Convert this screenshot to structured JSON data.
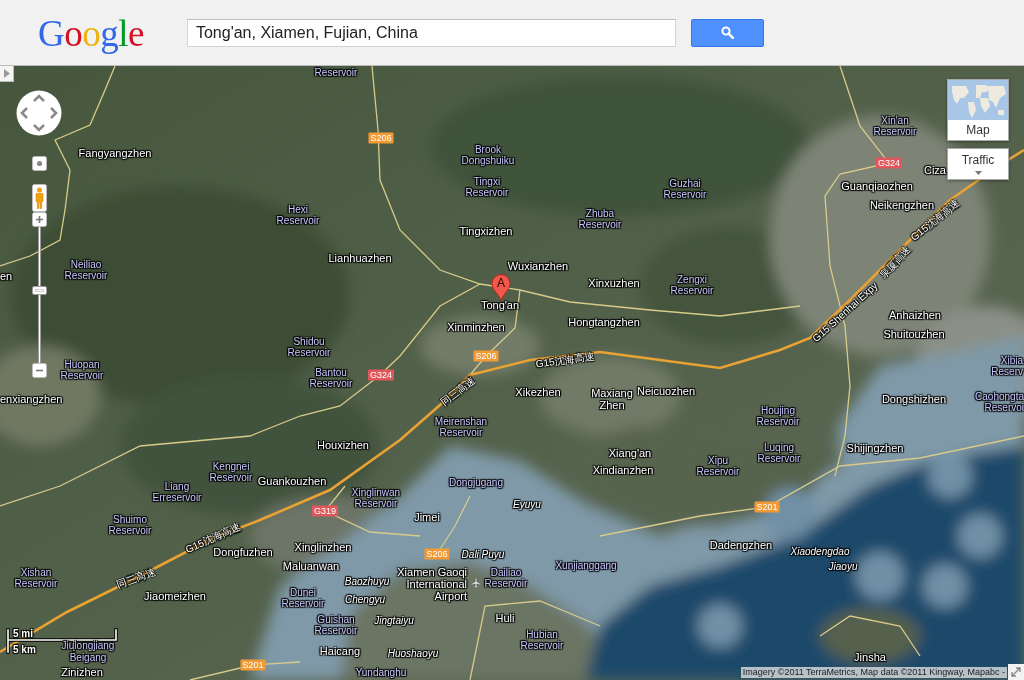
{
  "header": {
    "logo": "Google",
    "search": {
      "value": "Tong'an, Xiamen, Fujian, China"
    }
  },
  "map": {
    "labels": [
      {
        "kind": "water",
        "lines": [
          "Reservoir"
        ]
      },
      {
        "kind": "water",
        "lines": [
          "Xin'an",
          "Reservoir"
        ]
      },
      {
        "kind": "town",
        "lines": [
          "Fangyangzhen"
        ]
      },
      {
        "kind": "water",
        "lines": [
          "Brook",
          "Dongshuiku"
        ]
      },
      {
        "kind": "town",
        "lines": [
          "Ciza"
        ]
      },
      {
        "kind": "water",
        "lines": [
          "Tingxi",
          "Reservoir"
        ]
      },
      {
        "kind": "water",
        "lines": [
          "Guzhai",
          "Reservoir"
        ]
      },
      {
        "kind": "town",
        "lines": [
          "Guanqiaozhen"
        ]
      },
      {
        "kind": "water",
        "lines": [
          "Hexi",
          "Reservoir"
        ]
      },
      {
        "kind": "water",
        "lines": [
          "Zhuba",
          "Reservoir"
        ]
      },
      {
        "kind": "town",
        "lines": [
          "Neikengzhen"
        ]
      },
      {
        "kind": "town",
        "lines": [
          "Tingxizhen"
        ]
      },
      {
        "kind": "town",
        "lines": [
          "en"
        ]
      },
      {
        "kind": "water",
        "lines": [
          "Neiliao",
          "Reservoir"
        ]
      },
      {
        "kind": "town",
        "lines": [
          "Lianhuazhen"
        ]
      },
      {
        "kind": "town",
        "lines": [
          "Wuxianzhen"
        ]
      },
      {
        "kind": "town",
        "lines": [
          "Xinxuzhen"
        ]
      },
      {
        "kind": "water",
        "lines": [
          "Zengxi",
          "Reservoir"
        ]
      },
      {
        "kind": "town",
        "lines": [
          "Tong'an"
        ]
      },
      {
        "kind": "town",
        "lines": [
          "Xinminzhen"
        ]
      },
      {
        "kind": "town",
        "lines": [
          "Hongtangzhen"
        ]
      },
      {
        "kind": "town",
        "lines": [
          "Anhaizhen"
        ]
      },
      {
        "kind": "town",
        "lines": [
          "Shuitouzhen"
        ]
      },
      {
        "kind": "water",
        "lines": [
          "Shidou",
          "Reservoir"
        ]
      },
      {
        "kind": "water",
        "lines": [
          "Huopan",
          "Reservoir"
        ]
      },
      {
        "kind": "water",
        "lines": [
          "Bantou",
          "Reservoir"
        ]
      },
      {
        "kind": "water",
        "lines": [
          "Xibia",
          "Reserv"
        ]
      },
      {
        "kind": "town",
        "lines": [
          "enxiangzhen"
        ]
      },
      {
        "kind": "town",
        "lines": [
          "Xikezhen"
        ]
      },
      {
        "kind": "town",
        "lines": [
          "Maxiang",
          "Zhen"
        ]
      },
      {
        "kind": "town",
        "lines": [
          "Neicuozhen"
        ]
      },
      {
        "kind": "town",
        "lines": [
          "Dongshizhen"
        ]
      },
      {
        "kind": "water",
        "lines": [
          "Caohongta",
          "Reservoi"
        ]
      },
      {
        "kind": "water",
        "lines": [
          "Meirenshan",
          "Reservoir"
        ]
      },
      {
        "kind": "water",
        "lines": [
          "Houjing",
          "Reservoir"
        ]
      },
      {
        "kind": "town",
        "lines": [
          "Houxizhen"
        ]
      },
      {
        "kind": "town",
        "lines": [
          "Xiang'an"
        ]
      },
      {
        "kind": "water",
        "lines": [
          "Luqing",
          "Reservoir"
        ]
      },
      {
        "kind": "town",
        "lines": [
          "Shijingzhen"
        ]
      },
      {
        "kind": "water",
        "lines": [
          "Kengnei",
          "Reservoir"
        ]
      },
      {
        "kind": "town",
        "lines": [
          "Xindianzhen"
        ]
      },
      {
        "kind": "water",
        "lines": [
          "Xipu",
          "Reservoir"
        ]
      },
      {
        "kind": "water",
        "lines": [
          "Liang",
          "Erreservoir"
        ]
      },
      {
        "kind": "town",
        "lines": [
          "Guankouzhen"
        ]
      },
      {
        "kind": "water",
        "lines": [
          "Dongjugang"
        ]
      },
      {
        "kind": "water",
        "lines": [
          "Xinglinwan",
          "Reservoir"
        ]
      },
      {
        "kind": "island",
        "lines": [
          "Eyuyu"
        ]
      },
      {
        "kind": "water",
        "lines": [
          "Shuimo",
          "Reservoir"
        ]
      },
      {
        "kind": "town",
        "lines": [
          "Jimei"
        ]
      },
      {
        "kind": "town",
        "lines": [
          "Dongfuzhen"
        ]
      },
      {
        "kind": "town",
        "lines": [
          "Xinglinzhen"
        ]
      },
      {
        "kind": "island",
        "lines": [
          "Dali Puyu"
        ]
      },
      {
        "kind": "town",
        "lines": [
          "Dadengzhen"
        ]
      },
      {
        "kind": "island",
        "lines": [
          "Xiaodengdao"
        ]
      },
      {
        "kind": "town",
        "lines": [
          "Maluanwan"
        ]
      },
      {
        "kind": "water",
        "lines": [
          "Xunjianggang"
        ]
      },
      {
        "kind": "water",
        "lines": [
          "Xishan",
          "Reservoir"
        ]
      },
      {
        "kind": "island",
        "lines": [
          "Baozhuyu"
        ]
      },
      {
        "kind": "town",
        "lines": [
          "Jiaomeizhen"
        ]
      },
      {
        "kind": "water",
        "lines": [
          "Dunei",
          "Reservoir"
        ]
      },
      {
        "kind": "island",
        "lines": [
          "Chengyu"
        ]
      },
      {
        "kind": "airport",
        "lines": [
          "Xiamen Gaoqi",
          "International",
          "Airport"
        ]
      },
      {
        "kind": "water",
        "lines": [
          "Dailiao",
          "Reservoir"
        ]
      },
      {
        "kind": "island",
        "lines": [
          "Jiaoyu"
        ]
      },
      {
        "kind": "water",
        "lines": [
          "Guishan",
          "Reservoir"
        ]
      },
      {
        "kind": "island",
        "lines": [
          "Jingtaiyu"
        ]
      },
      {
        "kind": "town",
        "lines": [
          "Huli"
        ]
      },
      {
        "kind": "water",
        "lines": [
          "Jiulongjiang"
        ]
      },
      {
        "kind": "water",
        "lines": [
          "Beigang"
        ]
      },
      {
        "kind": "town",
        "lines": [
          "Haicang"
        ]
      },
      {
        "kind": "water",
        "lines": [
          "Hubian",
          "Reservoir"
        ]
      },
      {
        "kind": "island",
        "lines": [
          "Huoshaoyu"
        ]
      },
      {
        "kind": "town",
        "lines": [
          "Jinsha"
        ]
      },
      {
        "kind": "town",
        "lines": [
          "Zinizhen"
        ]
      },
      {
        "kind": "water",
        "lines": [
          "Yundanghu"
        ]
      }
    ],
    "road_shields": [
      {
        "text": "S206",
        "color": "#f29b36"
      },
      {
        "text": "G324",
        "color": "#e0585c"
      },
      {
        "text": "S206",
        "color": "#f29b36"
      },
      {
        "text": "G324",
        "color": "#e0585c"
      },
      {
        "text": "S201",
        "color": "#f29b36"
      },
      {
        "text": "G319",
        "color": "#e0585c"
      },
      {
        "text": "S206",
        "color": "#f29b36"
      },
      {
        "text": "S201",
        "color": "#f29b36"
      }
    ],
    "road_names": [
      "G15沈海高速",
      "泉厦高速",
      "G15 Shenhai Expy",
      "G15沈海高速",
      "同三高速",
      "G15沈海高速",
      "同三高速"
    ],
    "marker": {
      "letter": "A"
    },
    "zoom_slider": {
      "level": 0.53
    },
    "map_type_button": "Map",
    "traffic_button": "Traffic",
    "scale": {
      "miles": "5 mi",
      "kilometers": "5 km"
    },
    "attribution": "Imagery ©2011 TerraMetrics, Map data ©2011 Kingway, Mapabc -"
  }
}
